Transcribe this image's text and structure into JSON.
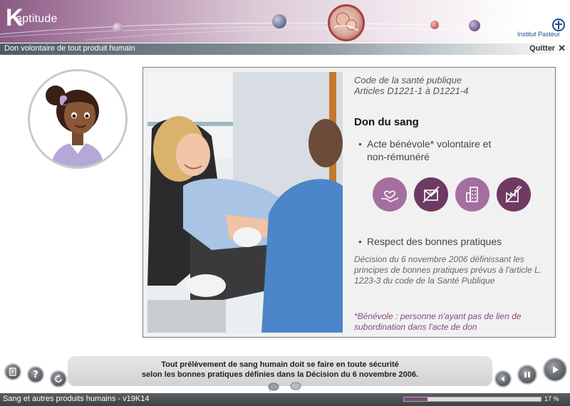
{
  "app": {
    "logo_text": "aptitude",
    "logo_letter": "K",
    "partner": "Institut Pasteur"
  },
  "titlebar": {
    "title": "Don volontaire de tout produit humain",
    "quit_label": "Quitter"
  },
  "content": {
    "reference_line1": "Code de la santé publique",
    "reference_line2": "Articles D1221-1 à D1221-4",
    "heading": "Don du sang",
    "bullet1_line1": "Acte bénévole* volontaire et",
    "bullet1_line2": "non-rémunéré",
    "icons": [
      "heart-hand-icon",
      "no-money-icon",
      "building-icon",
      "no-factory-icon"
    ],
    "bullet2": "Respect des bonnes pratiques",
    "decision_text": "Décision du 6 novembre 2006 définissant les principes de bonnes pratiques prévus à l'article L. 1223-3 du code de la Santé Publique",
    "note_text": "*Bénévole : personne n'ayant pas de lien de subordination dans l'acte de don"
  },
  "caption": {
    "line1": "Tout prélèvement de sang humain doit se faire en toute sécurité",
    "line2": "selon les bonnes pratiques définies dans la Décision du 6 novembre 2006."
  },
  "footer": {
    "course": "Sang et autres produits humains - v19K14",
    "progress_percent": 17,
    "progress_label": "17 %"
  },
  "colors": {
    "brand_purple": "#7a4c78",
    "icon_light": "#a46f9e",
    "icon_dark": "#6e3a62",
    "note_purple": "#8a4a80"
  }
}
